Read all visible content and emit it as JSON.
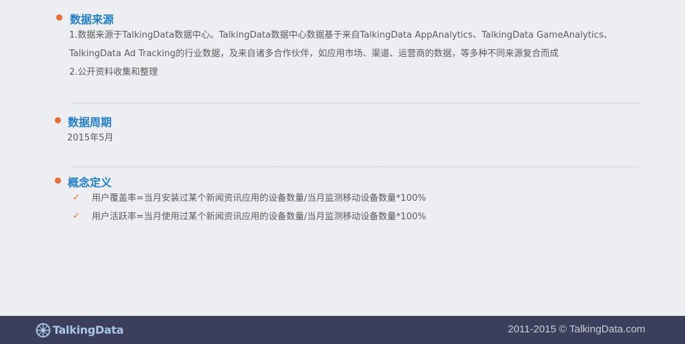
{
  "sections": {
    "source": {
      "title": "数据来源",
      "lines": [
        "1.数据来源于TalkingData数据中心。TalkingData数据中心数据基于来自TalkingData AppAnalytics、TalkingData GameAnalytics、",
        "TalkingData Ad Tracking的行业数据，及来自诸多合作伙伴，如应用市场、渠道、运营商的数据，等多种不同来源复合而成",
        "2.公开资料收集和整理"
      ]
    },
    "period": {
      "title": "数据周期",
      "value": "2015年5月"
    },
    "definitions": {
      "title": "概念定义",
      "items": [
        "用户覆盖率=当月安装过某个新闻资讯应用的设备数量/当月监测移动设备数量*100%",
        "用户活跃率=当月使用过某个新闻资讯应用的设备数量/当月监测移动设备数量*100%"
      ],
      "check_glyph": "✓"
    }
  },
  "footer": {
    "logo_text": "TalkingData",
    "copyright": "2011-2015 © TalkingData.com"
  },
  "colors": {
    "accent": "#ec6b2e",
    "heading": "#1f7ed0",
    "footer_bg": "#3b3f5b"
  }
}
